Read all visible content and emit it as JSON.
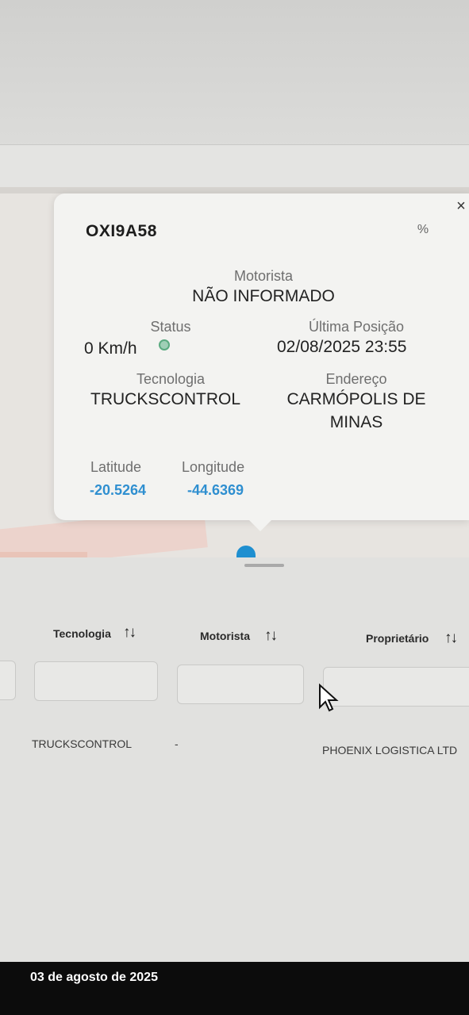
{
  "popup": {
    "plate": "OXI9A58",
    "close_label": "×",
    "link_icon": "%",
    "driver_label": "Motorista",
    "driver_value": "NÃO INFORMADO",
    "status_label": "Status",
    "status_value": "0 Km/h",
    "last_position_label": "Última Posição",
    "last_position_value": "02/08/2025 23:55",
    "technology_label": "Tecnologia",
    "technology_value": "TRUCKSCONTROL",
    "address_label": "Endereço",
    "address_line1": "CARMÓPOLIS DE",
    "address_line2": "MINAS",
    "latitude_label": "Latitude",
    "latitude_value": "-20.5264",
    "longitude_label": "Longitude",
    "longitude_value": "-44.6369"
  },
  "table": {
    "columns": [
      {
        "label": "Tecnologia",
        "sort_icon": "↑↓"
      },
      {
        "label": "Motorista",
        "sort_icon": "↑↓"
      },
      {
        "label": "Proprietário",
        "sort_icon": "↑↓"
      }
    ],
    "rows": [
      {
        "tecnologia": "TRUCKSCONTROL",
        "motorista": "-",
        "proprietario": "PHOENIX LOGISTICA LTD"
      }
    ]
  },
  "caption": {
    "date": "03 de agosto de 2025"
  },
  "colors": {
    "accent_blue": "#2f8fd0",
    "status_green": "#5aaa80"
  }
}
